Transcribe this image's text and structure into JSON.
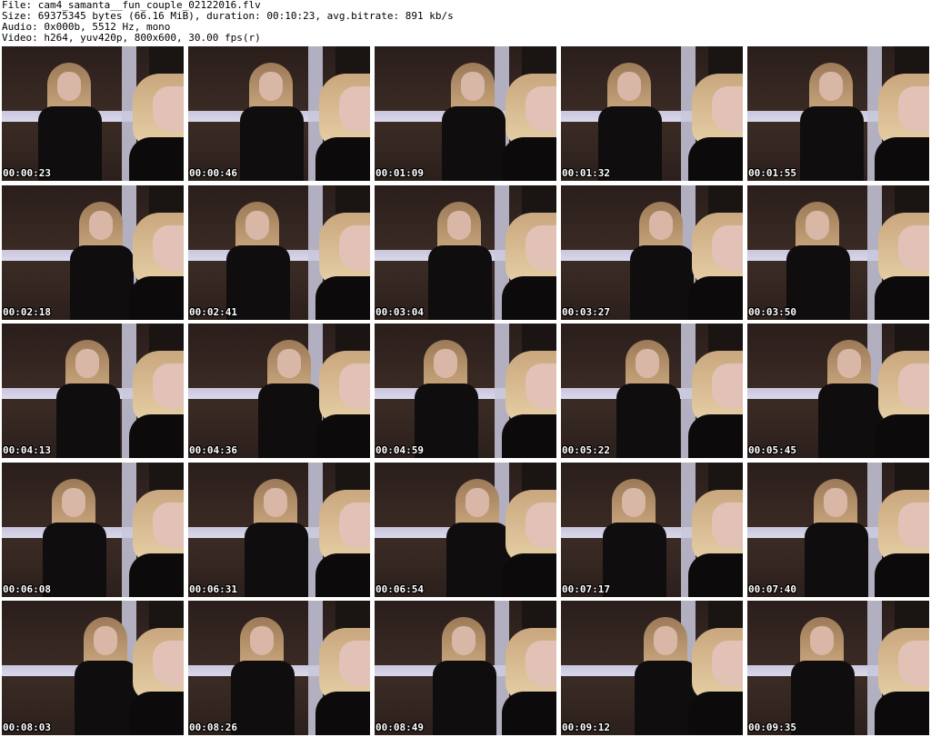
{
  "header": {
    "file_line": "File: cam4_samanta__fun_couple_02122016.flv",
    "size_line": "Size: 69375345 bytes (66.16 MiB), duration: 00:10:23, avg.bitrate: 891 kb/s",
    "audio_line": "Audio: 0x000b, 5512 Hz, mono",
    "video_line": "Video: h264, yuv420p, 800x600, 30.00 fps(r)"
  },
  "thumbnails": [
    {
      "timestamp": "00:00:23"
    },
    {
      "timestamp": "00:00:46"
    },
    {
      "timestamp": "00:01:09"
    },
    {
      "timestamp": "00:01:32"
    },
    {
      "timestamp": "00:01:55"
    },
    {
      "timestamp": "00:02:18"
    },
    {
      "timestamp": "00:02:41"
    },
    {
      "timestamp": "00:03:04"
    },
    {
      "timestamp": "00:03:27"
    },
    {
      "timestamp": "00:03:50"
    },
    {
      "timestamp": "00:04:13"
    },
    {
      "timestamp": "00:04:36"
    },
    {
      "timestamp": "00:04:59"
    },
    {
      "timestamp": "00:05:22"
    },
    {
      "timestamp": "00:05:45"
    },
    {
      "timestamp": "00:06:08"
    },
    {
      "timestamp": "00:06:31"
    },
    {
      "timestamp": "00:06:54"
    },
    {
      "timestamp": "00:07:17"
    },
    {
      "timestamp": "00:07:40"
    },
    {
      "timestamp": "00:08:03"
    },
    {
      "timestamp": "00:08:26"
    },
    {
      "timestamp": "00:08:49"
    },
    {
      "timestamp": "00:09:12"
    },
    {
      "timestamp": "00:09:35"
    }
  ],
  "colors": {
    "background": "#ffffff",
    "header_text": "#000000",
    "timestamp_text": "#ffffff",
    "timestamp_outline": "#000000"
  }
}
